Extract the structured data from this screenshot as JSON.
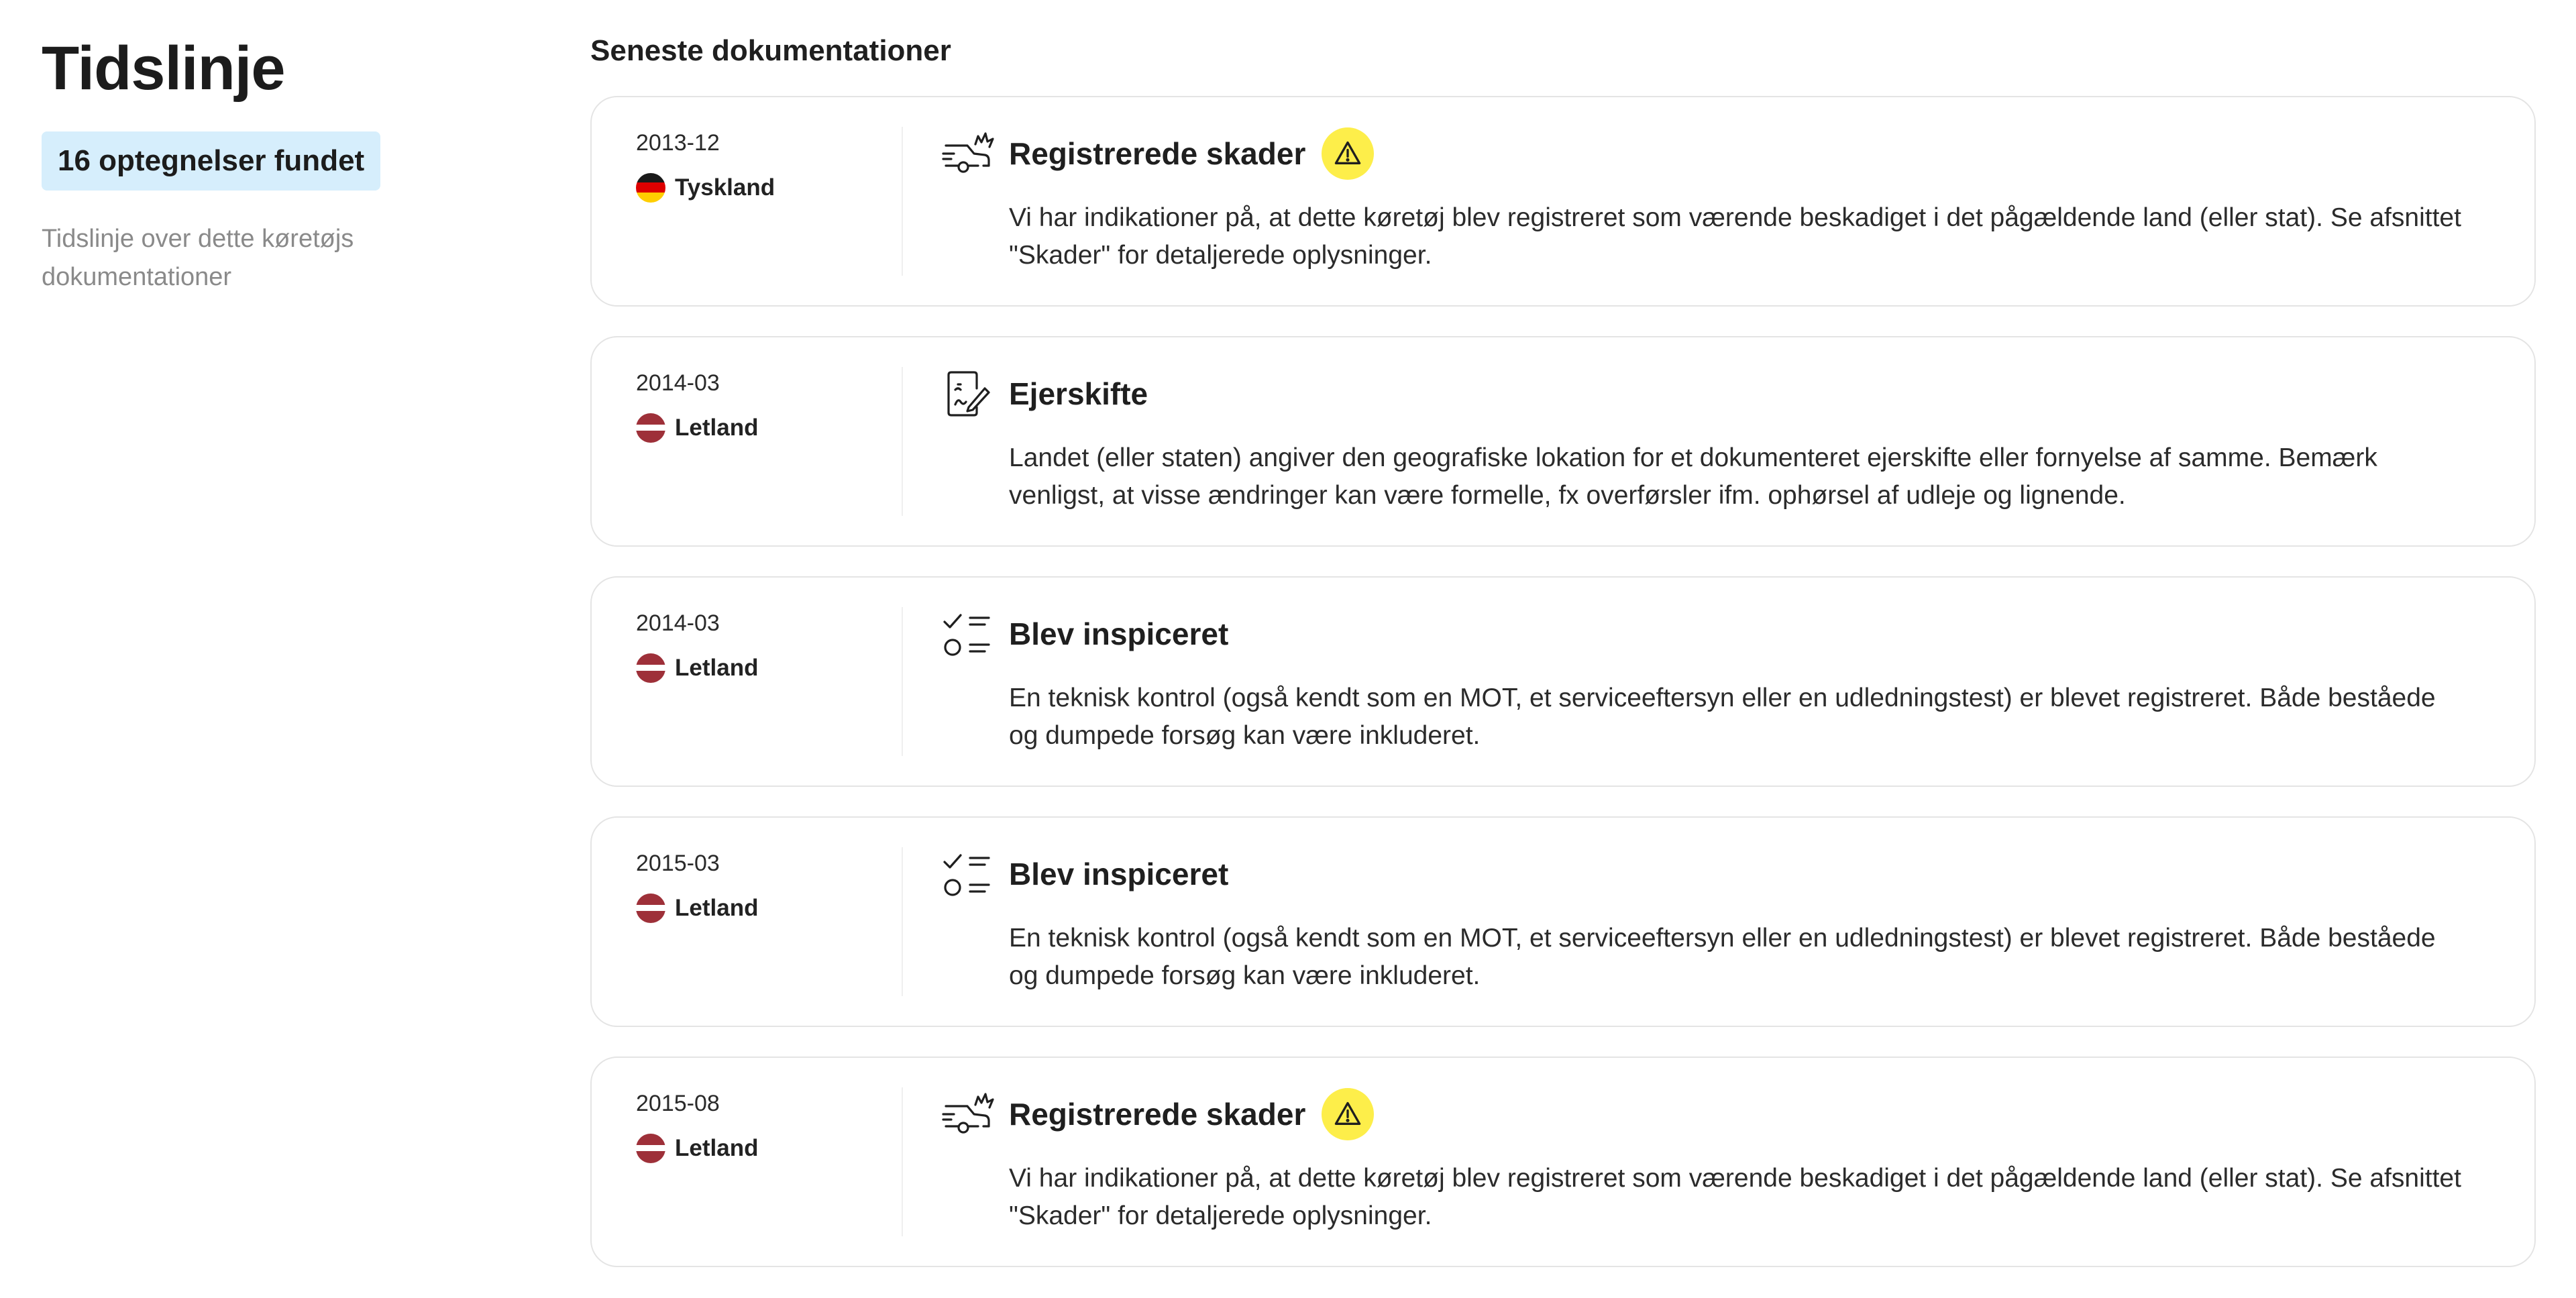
{
  "sidebar": {
    "title": "Tidslinje",
    "count_badge": "16 optegnelser fundet",
    "description": "Tidslinje over dette køretøjs dokumentationer"
  },
  "main": {
    "section_title": "Seneste dokumentationer",
    "colors": {
      "badge_bg": "#d6eefc",
      "warning_bg": "#fdee4a",
      "card_border": "#e4e4e4",
      "muted_text": "#8a8a8a"
    },
    "records": [
      {
        "date": "2013-12",
        "country": "Tyskland",
        "flag": "germany",
        "icon": "crash-car-icon",
        "title": "Registrerede skader",
        "warning": true,
        "text": "Vi har indikationer på, at dette køretøj blev registreret som værende beskadiget i det pågældende land (eller stat). Se afsnittet \"Skader\" for detaljerede oplysninger."
      },
      {
        "date": "2014-03",
        "country": "Letland",
        "flag": "latvia",
        "icon": "ownership-document-icon",
        "title": "Ejerskifte",
        "warning": false,
        "text": "Landet (eller staten) angiver den geografiske lokation for et dokumenteret ejerskifte eller fornyelse af samme. Bemærk venligst, at visse ændringer kan være formelle, fx overførsler ifm. ophørsel af udleje og lignende."
      },
      {
        "date": "2014-03",
        "country": "Letland",
        "flag": "latvia",
        "icon": "checklist-icon",
        "title": "Blev inspiceret",
        "warning": false,
        "text": "En teknisk kontrol (også kendt som en MOT, et serviceeftersyn eller en udledningstest) er blevet registreret. Både beståede og dumpede forsøg kan være inkluderet."
      },
      {
        "date": "2015-03",
        "country": "Letland",
        "flag": "latvia",
        "icon": "checklist-icon",
        "title": "Blev inspiceret",
        "warning": false,
        "text": "En teknisk kontrol (også kendt som en MOT, et serviceeftersyn eller en udledningstest) er blevet registreret. Både beståede og dumpede forsøg kan være inkluderet."
      },
      {
        "date": "2015-08",
        "country": "Letland",
        "flag": "latvia",
        "icon": "crash-car-icon",
        "title": "Registrerede skader",
        "warning": true,
        "text": "Vi har indikationer på, at dette køretøj blev registreret som værende beskadiget i det pågældende land (eller stat). Se afsnittet \"Skader\" for detaljerede oplysninger."
      }
    ]
  }
}
